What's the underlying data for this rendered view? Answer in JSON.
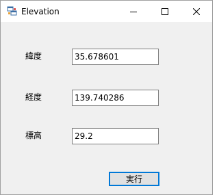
{
  "window": {
    "title": "Elevation"
  },
  "form": {
    "latitude": {
      "label": "緯度",
      "value": "35.678601"
    },
    "longitude": {
      "label": "経度",
      "value": "139.740286"
    },
    "elevation": {
      "label": "標高",
      "value": "29.2"
    },
    "run_label": "実行"
  },
  "icons": {
    "app": "app-window-icon",
    "minimize": "minimize-icon",
    "maximize": "maximize-icon",
    "close": "close-icon"
  }
}
